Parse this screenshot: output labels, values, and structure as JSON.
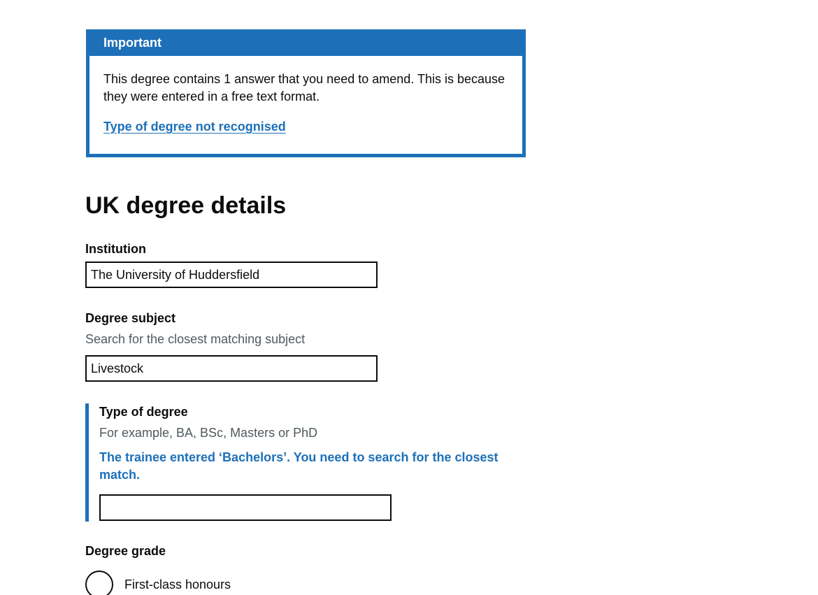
{
  "banner": {
    "title": "Important",
    "text": "This degree contains 1 answer that you need to amend. This is because they were entered in a free text format.",
    "link": "Type of degree not recognised"
  },
  "page": {
    "title": "UK degree details"
  },
  "institution": {
    "label": "Institution",
    "value": "The University of Huddersfield"
  },
  "subject": {
    "label": "Degree subject",
    "hint": "Search for the closest matching subject",
    "value": "Livestock"
  },
  "degree_type": {
    "label": "Type of degree",
    "hint": "For example, BA, BSc, Masters or PhD",
    "message": "The trainee entered ‘Bachelors’. You need to search for the closest match.",
    "value": ""
  },
  "grade": {
    "label": "Degree grade",
    "options": [
      {
        "label": "First-class honours"
      }
    ]
  },
  "colors": {
    "brand_blue": "#1d70b8",
    "text": "#0b0c0c",
    "hint": "#505a5f"
  }
}
